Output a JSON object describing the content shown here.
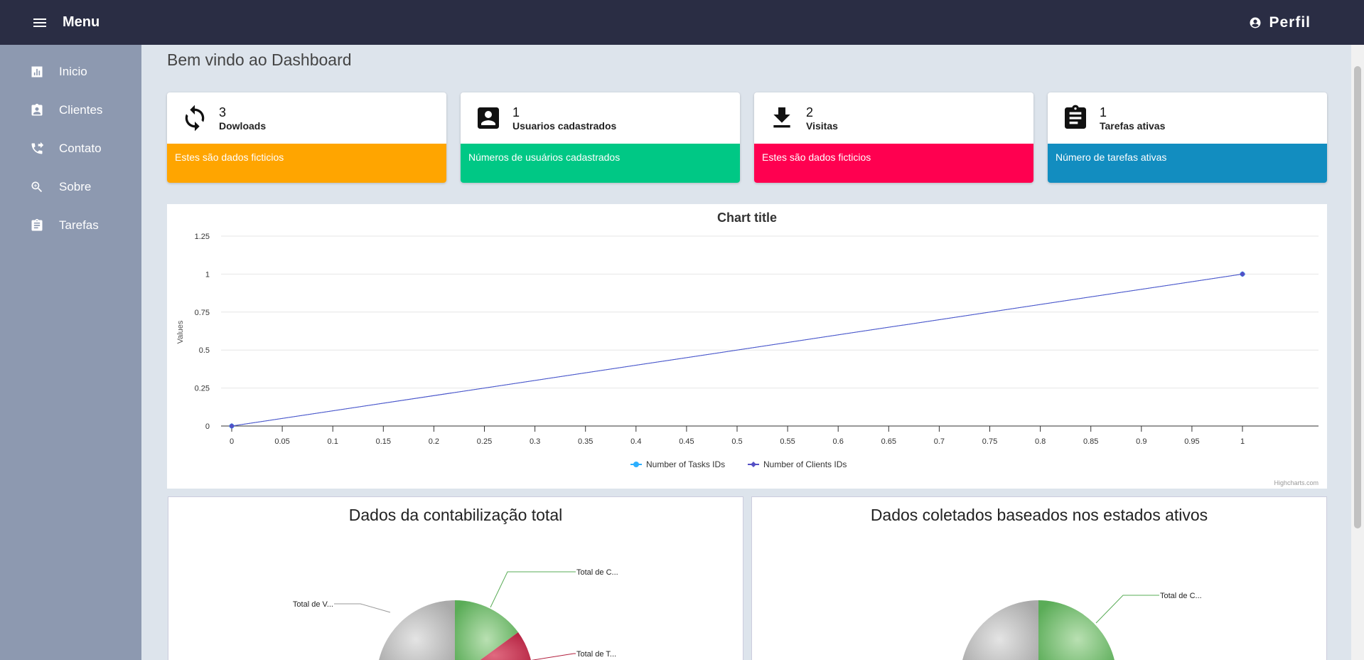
{
  "topbar": {
    "menu_label": "Menu",
    "profile_label": "Perfil"
  },
  "sidebar": {
    "items": [
      {
        "label": "Inicio",
        "icon": "bar-chart-icon"
      },
      {
        "label": "Clientes",
        "icon": "contact-card-icon"
      },
      {
        "label": "Contato",
        "icon": "phone-forward-icon"
      },
      {
        "label": "Sobre",
        "icon": "zoom-icon"
      },
      {
        "label": "Tarefas",
        "icon": "clipboard-icon"
      }
    ]
  },
  "page_title": "Bem vindo ao Dashboard",
  "cards": [
    {
      "value": "3",
      "label": "Dowloads",
      "footer": "Estes são dados ficticios",
      "color": "#ffa500",
      "icon": "sync-icon"
    },
    {
      "value": "1",
      "label": "Usuarios cadastrados",
      "footer": "Números de usuários cadastrados",
      "color": "#00c885",
      "icon": "account-box-icon"
    },
    {
      "value": "2",
      "label": "Visitas",
      "footer": "Estes são dados ficticios",
      "color": "#ff0050",
      "icon": "download-icon"
    },
    {
      "value": "1",
      "label": "Tarefas ativas",
      "footer": "Número de tarefas ativas",
      "color": "#128dc0",
      "icon": "clipboard-icon"
    }
  ],
  "chart_data": {
    "type": "line",
    "title": "Chart title",
    "xlabel": "",
    "ylabel": "Values",
    "xlim": [
      0,
      1
    ],
    "ylim": [
      0,
      1.25
    ],
    "x_ticks": [
      "0",
      "0.05",
      "0.1",
      "0.15",
      "0.2",
      "0.25",
      "0.3",
      "0.35",
      "0.4",
      "0.45",
      "0.5",
      "0.55",
      "0.6",
      "0.65",
      "0.7",
      "0.75",
      "0.8",
      "0.85",
      "0.9",
      "0.95",
      "1"
    ],
    "y_ticks": [
      "0",
      "0.25",
      "0.5",
      "0.75",
      "1",
      "1.25"
    ],
    "series": [
      {
        "name": "Number of Tasks IDs",
        "color": "#2caffe",
        "x": [
          0,
          1
        ],
        "y": [
          0,
          1
        ]
      },
      {
        "name": "Number of Clients IDs",
        "color": "#544fc5",
        "x": [
          0,
          1
        ],
        "y": [
          0,
          1
        ]
      }
    ],
    "grid": true,
    "legend": "bottom",
    "credits": "Highcharts.com"
  },
  "pie_charts": [
    {
      "title": "Dados da contabilização total",
      "labels": [
        "Total de C...",
        "Total de T...",
        "Total de V..."
      ]
    },
    {
      "title": "Dados coletados baseados nos estados ativos",
      "labels": [
        "Total de C..."
      ]
    }
  ]
}
